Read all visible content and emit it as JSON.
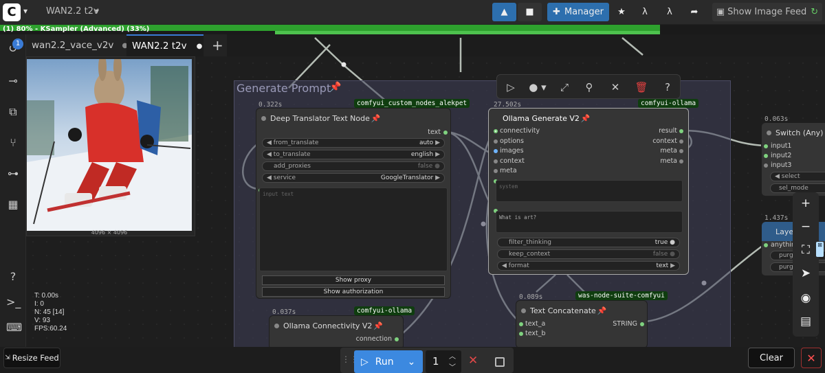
{
  "topbar": {
    "workflow_name": "WAN2.2 t2v",
    "manager_label": "Manager",
    "show_image_feed_label": "Show Image Feed"
  },
  "progress": {
    "text": "(1) 80% - KSampler (Advanced) (33%)",
    "overall_fraction": 0.8,
    "step_fraction": 0.33
  },
  "tabs": [
    {
      "label": "wan2.2_vace_v2v",
      "active": false
    },
    {
      "label": "WAN2.2 t2v",
      "active": true
    }
  ],
  "queue": {
    "badge_count": "1",
    "image_size": "4096 × 4096"
  },
  "group": {
    "title": "Generate Prompt"
  },
  "nodes": {
    "deep_translator": {
      "timing": "0.322s",
      "badge": "comfyui_custom_nodes_alekpet",
      "title": "Deep Translator Text Node",
      "output_text": "text",
      "from_translate_label": "from_translate",
      "from_translate_value": "auto",
      "to_translate_label": "to_translate",
      "to_translate_value": "english",
      "add_proxies_label": "add_proxies",
      "add_proxies_value": "false",
      "service_label": "service",
      "service_value": "GoogleTranslator",
      "input_placeholder": "input text",
      "show_proxy_label": "Show proxy",
      "show_auth_label": "Show authorization"
    },
    "ollama_generate": {
      "timing": "27.502s",
      "badge": "comfyui-ollama",
      "title": "Ollama Generate V2",
      "inputs": [
        "connectivity",
        "options",
        "images",
        "context",
        "meta"
      ],
      "outputs": [
        "result",
        "context",
        "meta",
        "meta"
      ],
      "system_placeholder": "system",
      "prompt_text": "What is art?",
      "filter_thinking_label": "filter_thinking",
      "filter_thinking_value": "true",
      "keep_context_label": "keep_context",
      "keep_context_value": "false",
      "format_label": "format",
      "format_value": "text"
    },
    "ollama_connectivity": {
      "timing": "0.037s",
      "badge": "comfyui-ollama",
      "title": "Ollama Connectivity V2",
      "output": "connection"
    },
    "text_concatenate": {
      "timing": "0.089s",
      "badge": "was-node-suite-comfyui",
      "title": "Text Concatenate",
      "inputs": [
        "text_a",
        "text_b"
      ],
      "output": "STRING"
    },
    "switch_any": {
      "timing": "0.063s",
      "title": "Switch (Any)",
      "inputs": [
        "input1",
        "input2",
        "input3"
      ],
      "select_label": "select",
      "sel_mode_label": "sel_mode"
    },
    "layer_node": {
      "timing": "1.437s",
      "title": "Layer",
      "inputs": [
        "anything",
        "purge",
        "purge"
      ]
    }
  },
  "stats": {
    "t": "T: 0.00s",
    "i": "I: 0",
    "n": "N: 45 [14]",
    "v": "V: 93",
    "fps": "FPS:60.24"
  },
  "bottombar": {
    "resize_feed_label": "Resize Feed",
    "run_label": "Run",
    "batch_count": "1",
    "clear_label": "Clear"
  },
  "colors": {
    "accent_blue": "#2d6fae",
    "progress_green": "#2ea12e",
    "group_bg": "#3f3f5a",
    "badge_green": "#0f3d0f"
  }
}
